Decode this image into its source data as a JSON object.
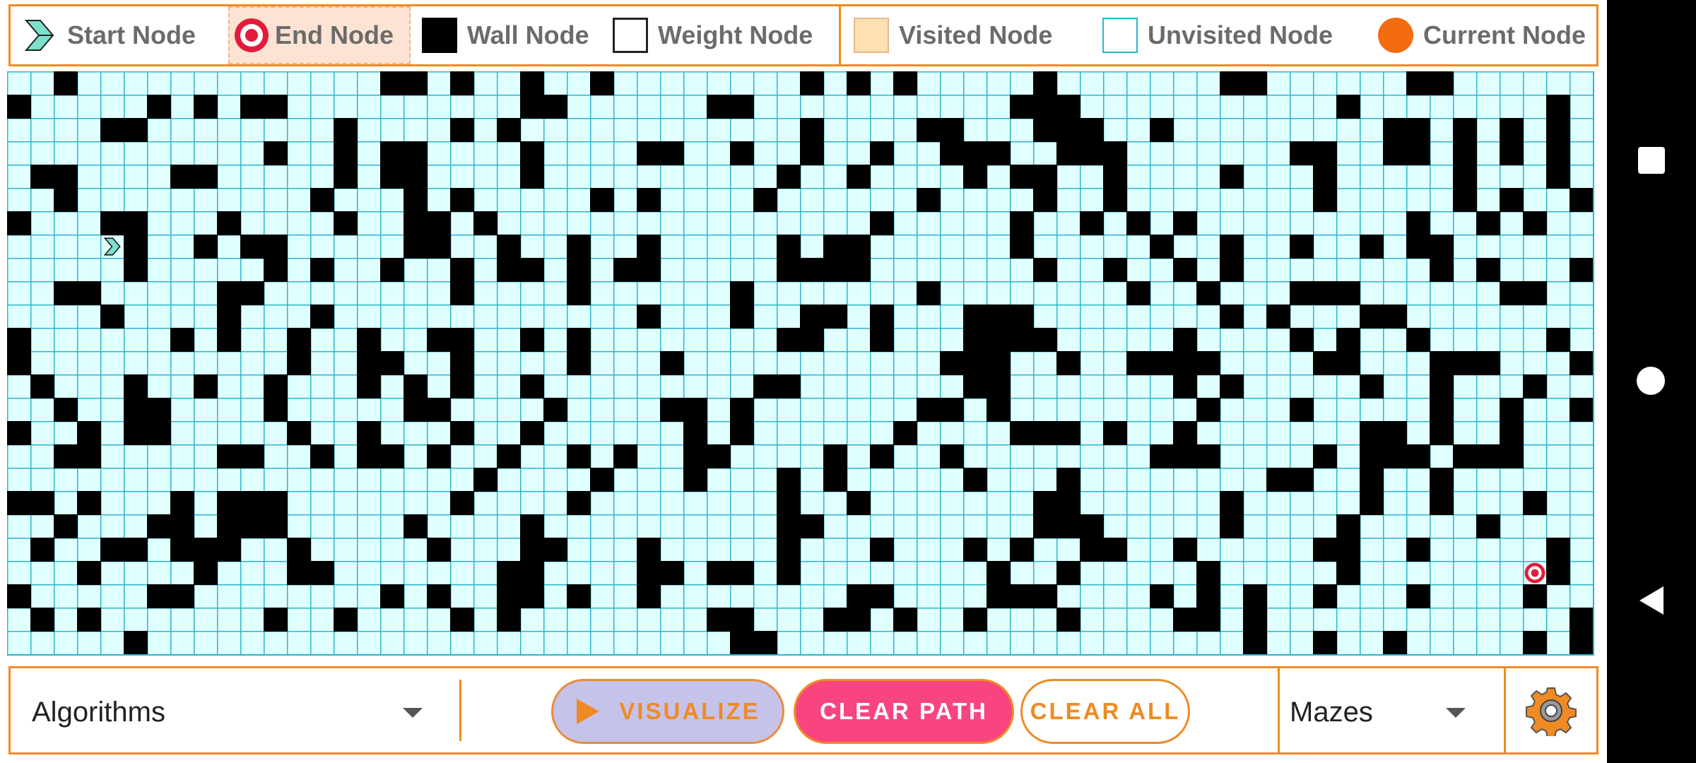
{
  "legend": {
    "start_label": "Start Node",
    "end_label": "End Node",
    "wall_label": "Wall Node",
    "weight_label": "Weight Node",
    "visited_label": "Visited Node",
    "unvisited_label": "Unvisited Node",
    "current_label": "Current Node"
  },
  "toolbar": {
    "algorithms_label": "Algorithms",
    "visualize_label": "VISUALIZE",
    "clear_path_label": "CLEAR PATH",
    "clear_all_label": "CLEAR ALL",
    "mazes_label": "Mazes"
  },
  "colors": {
    "accent": "#f08a24",
    "grid_line": "#2bb6cc",
    "unvisited": "#e0ffff",
    "visited": "#ffe0b2",
    "wall": "#000000",
    "start": "#7be0cc",
    "end": "#e31b3a",
    "current": "#f36c10",
    "clear_path_bg": "#f8457f",
    "visualize_bg": "#c5c3e9"
  },
  "icons": {
    "start": "start-chevron-icon",
    "end": "target-icon",
    "settings": "gear-icon",
    "play": "play-icon",
    "dropdown": "chevron-down-icon"
  },
  "grid": {
    "cols": 68,
    "rows": 25,
    "start": [
      7,
      4
    ],
    "end": [
      21,
      65
    ],
    "walls": [
      [
        0,
        2
      ],
      [
        0,
        16
      ],
      [
        0,
        17
      ],
      [
        0,
        19
      ],
      [
        0,
        22
      ],
      [
        0,
        25
      ],
      [
        0,
        34
      ],
      [
        0,
        36
      ],
      [
        0,
        38
      ],
      [
        0,
        44
      ],
      [
        0,
        52
      ],
      [
        0,
        53
      ],
      [
        0,
        60
      ],
      [
        0,
        61
      ],
      [
        1,
        0
      ],
      [
        1,
        6
      ],
      [
        1,
        8
      ],
      [
        1,
        10
      ],
      [
        1,
        11
      ],
      [
        1,
        22
      ],
      [
        1,
        23
      ],
      [
        1,
        30
      ],
      [
        1,
        31
      ],
      [
        1,
        43
      ],
      [
        1,
        44
      ],
      [
        1,
        45
      ],
      [
        1,
        57
      ],
      [
        1,
        66
      ],
      [
        2,
        4
      ],
      [
        2,
        5
      ],
      [
        2,
        14
      ],
      [
        2,
        19
      ],
      [
        2,
        21
      ],
      [
        2,
        34
      ],
      [
        2,
        39
      ],
      [
        2,
        40
      ],
      [
        2,
        44
      ],
      [
        2,
        45
      ],
      [
        2,
        46
      ],
      [
        2,
        49
      ],
      [
        2,
        59
      ],
      [
        2,
        60
      ],
      [
        2,
        62
      ],
      [
        2,
        64
      ],
      [
        2,
        66
      ],
      [
        3,
        11
      ],
      [
        3,
        14
      ],
      [
        3,
        16
      ],
      [
        3,
        17
      ],
      [
        3,
        22
      ],
      [
        3,
        27
      ],
      [
        3,
        28
      ],
      [
        3,
        31
      ],
      [
        3,
        34
      ],
      [
        3,
        37
      ],
      [
        3,
        40
      ],
      [
        3,
        41
      ],
      [
        3,
        42
      ],
      [
        3,
        45
      ],
      [
        3,
        46
      ],
      [
        3,
        47
      ],
      [
        3,
        55
      ],
      [
        3,
        56
      ],
      [
        3,
        59
      ],
      [
        3,
        60
      ],
      [
        3,
        62
      ],
      [
        3,
        64
      ],
      [
        3,
        66
      ],
      [
        4,
        1
      ],
      [
        4,
        2
      ],
      [
        4,
        7
      ],
      [
        4,
        8
      ],
      [
        4,
        14
      ],
      [
        4,
        16
      ],
      [
        4,
        17
      ],
      [
        4,
        22
      ],
      [
        4,
        33
      ],
      [
        4,
        36
      ],
      [
        4,
        41
      ],
      [
        4,
        43
      ],
      [
        4,
        44
      ],
      [
        4,
        47
      ],
      [
        4,
        52
      ],
      [
        4,
        56
      ],
      [
        4,
        62
      ],
      [
        4,
        66
      ],
      [
        5,
        2
      ],
      [
        5,
        13
      ],
      [
        5,
        17
      ],
      [
        5,
        19
      ],
      [
        5,
        25
      ],
      [
        5,
        27
      ],
      [
        5,
        32
      ],
      [
        5,
        39
      ],
      [
        5,
        44
      ],
      [
        5,
        47
      ],
      [
        5,
        56
      ],
      [
        5,
        62
      ],
      [
        5,
        64
      ],
      [
        5,
        67
      ],
      [
        6,
        0
      ],
      [
        6,
        4
      ],
      [
        6,
        5
      ],
      [
        6,
        9
      ],
      [
        6,
        14
      ],
      [
        6,
        17
      ],
      [
        6,
        18
      ],
      [
        6,
        20
      ],
      [
        6,
        37
      ],
      [
        6,
        43
      ],
      [
        6,
        46
      ],
      [
        6,
        48
      ],
      [
        6,
        50
      ],
      [
        6,
        60
      ],
      [
        6,
        63
      ],
      [
        6,
        65
      ],
      [
        7,
        5
      ],
      [
        7,
        8
      ],
      [
        7,
        10
      ],
      [
        7,
        11
      ],
      [
        7,
        17
      ],
      [
        7,
        18
      ],
      [
        7,
        21
      ],
      [
        7,
        24
      ],
      [
        7,
        27
      ],
      [
        7,
        33
      ],
      [
        7,
        35
      ],
      [
        7,
        36
      ],
      [
        7,
        43
      ],
      [
        7,
        49
      ],
      [
        7,
        52
      ],
      [
        7,
        55
      ],
      [
        7,
        58
      ],
      [
        7,
        60
      ],
      [
        7,
        61
      ],
      [
        8,
        5
      ],
      [
        8,
        11
      ],
      [
        8,
        13
      ],
      [
        8,
        16
      ],
      [
        8,
        19
      ],
      [
        8,
        21
      ],
      [
        8,
        22
      ],
      [
        8,
        24
      ],
      [
        8,
        26
      ],
      [
        8,
        27
      ],
      [
        8,
        33
      ],
      [
        8,
        34
      ],
      [
        8,
        35
      ],
      [
        8,
        36
      ],
      [
        8,
        44
      ],
      [
        8,
        47
      ],
      [
        8,
        50
      ],
      [
        8,
        52
      ],
      [
        8,
        61
      ],
      [
        8,
        63
      ],
      [
        8,
        67
      ],
      [
        9,
        2
      ],
      [
        9,
        3
      ],
      [
        9,
        9
      ],
      [
        9,
        10
      ],
      [
        9,
        19
      ],
      [
        9,
        24
      ],
      [
        9,
        31
      ],
      [
        9,
        39
      ],
      [
        9,
        48
      ],
      [
        9,
        51
      ],
      [
        9,
        55
      ],
      [
        9,
        56
      ],
      [
        9,
        57
      ],
      [
        9,
        64
      ],
      [
        9,
        65
      ],
      [
        10,
        4
      ],
      [
        10,
        9
      ],
      [
        10,
        13
      ],
      [
        10,
        27
      ],
      [
        10,
        31
      ],
      [
        10,
        34
      ],
      [
        10,
        35
      ],
      [
        10,
        37
      ],
      [
        10,
        41
      ],
      [
        10,
        42
      ],
      [
        10,
        43
      ],
      [
        10,
        52
      ],
      [
        10,
        54
      ],
      [
        10,
        58
      ],
      [
        10,
        59
      ],
      [
        11,
        0
      ],
      [
        11,
        7
      ],
      [
        11,
        9
      ],
      [
        11,
        12
      ],
      [
        11,
        15
      ],
      [
        11,
        18
      ],
      [
        11,
        19
      ],
      [
        11,
        22
      ],
      [
        11,
        24
      ],
      [
        11,
        33
      ],
      [
        11,
        34
      ],
      [
        11,
        37
      ],
      [
        11,
        41
      ],
      [
        11,
        42
      ],
      [
        11,
        43
      ],
      [
        11,
        44
      ],
      [
        11,
        50
      ],
      [
        11,
        55
      ],
      [
        11,
        57
      ],
      [
        11,
        60
      ],
      [
        11,
        66
      ],
      [
        12,
        0
      ],
      [
        12,
        12
      ],
      [
        12,
        15
      ],
      [
        12,
        16
      ],
      [
        12,
        19
      ],
      [
        12,
        24
      ],
      [
        12,
        28
      ],
      [
        12,
        40
      ],
      [
        12,
        41
      ],
      [
        12,
        42
      ],
      [
        12,
        45
      ],
      [
        12,
        48
      ],
      [
        12,
        49
      ],
      [
        12,
        50
      ],
      [
        12,
        51
      ],
      [
        12,
        56
      ],
      [
        12,
        57
      ],
      [
        12,
        61
      ],
      [
        12,
        62
      ],
      [
        12,
        63
      ],
      [
        12,
        67
      ],
      [
        13,
        1
      ],
      [
        13,
        5
      ],
      [
        13,
        8
      ],
      [
        13,
        11
      ],
      [
        13,
        15
      ],
      [
        13,
        17
      ],
      [
        13,
        19
      ],
      [
        13,
        22
      ],
      [
        13,
        32
      ],
      [
        13,
        33
      ],
      [
        13,
        41
      ],
      [
        13,
        42
      ],
      [
        13,
        50
      ],
      [
        13,
        52
      ],
      [
        13,
        58
      ],
      [
        13,
        61
      ],
      [
        13,
        65
      ],
      [
        14,
        2
      ],
      [
        14,
        5
      ],
      [
        14,
        6
      ],
      [
        14,
        11
      ],
      [
        14,
        17
      ],
      [
        14,
        18
      ],
      [
        14,
        23
      ],
      [
        14,
        28
      ],
      [
        14,
        29
      ],
      [
        14,
        31
      ],
      [
        14,
        39
      ],
      [
        14,
        40
      ],
      [
        14,
        42
      ],
      [
        14,
        51
      ],
      [
        14,
        55
      ],
      [
        14,
        61
      ],
      [
        14,
        64
      ],
      [
        14,
        67
      ],
      [
        15,
        0
      ],
      [
        15,
        3
      ],
      [
        15,
        5
      ],
      [
        15,
        6
      ],
      [
        15,
        12
      ],
      [
        15,
        15
      ],
      [
        15,
        19
      ],
      [
        15,
        22
      ],
      [
        15,
        29
      ],
      [
        15,
        31
      ],
      [
        15,
        38
      ],
      [
        15,
        43
      ],
      [
        15,
        44
      ],
      [
        15,
        45
      ],
      [
        15,
        47
      ],
      [
        15,
        50
      ],
      [
        15,
        58
      ],
      [
        15,
        59
      ],
      [
        15,
        61
      ],
      [
        15,
        64
      ],
      [
        16,
        2
      ],
      [
        16,
        3
      ],
      [
        16,
        9
      ],
      [
        16,
        10
      ],
      [
        16,
        13
      ],
      [
        16,
        15
      ],
      [
        16,
        16
      ],
      [
        16,
        18
      ],
      [
        16,
        21
      ],
      [
        16,
        24
      ],
      [
        16,
        26
      ],
      [
        16,
        29
      ],
      [
        16,
        30
      ],
      [
        16,
        35
      ],
      [
        16,
        37
      ],
      [
        16,
        40
      ],
      [
        16,
        49
      ],
      [
        16,
        50
      ],
      [
        16,
        51
      ],
      [
        16,
        56
      ],
      [
        16,
        58
      ],
      [
        16,
        59
      ],
      [
        16,
        60
      ],
      [
        16,
        62
      ],
      [
        16,
        63
      ],
      [
        16,
        64
      ],
      [
        17,
        20
      ],
      [
        17,
        25
      ],
      [
        17,
        29
      ],
      [
        17,
        33
      ],
      [
        17,
        35
      ],
      [
        17,
        41
      ],
      [
        17,
        45
      ],
      [
        17,
        54
      ],
      [
        17,
        55
      ],
      [
        17,
        58
      ],
      [
        17,
        61
      ],
      [
        18,
        0
      ],
      [
        18,
        1
      ],
      [
        18,
        3
      ],
      [
        18,
        7
      ],
      [
        18,
        9
      ],
      [
        18,
        10
      ],
      [
        18,
        11
      ],
      [
        18,
        19
      ],
      [
        18,
        24
      ],
      [
        18,
        33
      ],
      [
        18,
        36
      ],
      [
        18,
        44
      ],
      [
        18,
        45
      ],
      [
        18,
        52
      ],
      [
        18,
        58
      ],
      [
        18,
        61
      ],
      [
        18,
        65
      ],
      [
        19,
        2
      ],
      [
        19,
        6
      ],
      [
        19,
        7
      ],
      [
        19,
        9
      ],
      [
        19,
        10
      ],
      [
        19,
        11
      ],
      [
        19,
        17
      ],
      [
        19,
        22
      ],
      [
        19,
        33
      ],
      [
        19,
        34
      ],
      [
        19,
        44
      ],
      [
        19,
        45
      ],
      [
        19,
        46
      ],
      [
        19,
        52
      ],
      [
        19,
        57
      ],
      [
        19,
        63
      ],
      [
        20,
        1
      ],
      [
        20,
        4
      ],
      [
        20,
        5
      ],
      [
        20,
        7
      ],
      [
        20,
        8
      ],
      [
        20,
        9
      ],
      [
        20,
        12
      ],
      [
        20,
        18
      ],
      [
        20,
        22
      ],
      [
        20,
        23
      ],
      [
        20,
        27
      ],
      [
        20,
        33
      ],
      [
        20,
        37
      ],
      [
        20,
        41
      ],
      [
        20,
        43
      ],
      [
        20,
        46
      ],
      [
        20,
        47
      ],
      [
        20,
        50
      ],
      [
        20,
        56
      ],
      [
        20,
        57
      ],
      [
        20,
        60
      ],
      [
        20,
        66
      ],
      [
        21,
        3
      ],
      [
        21,
        8
      ],
      [
        21,
        12
      ],
      [
        21,
        13
      ],
      [
        21,
        21
      ],
      [
        21,
        22
      ],
      [
        21,
        27
      ],
      [
        21,
        28
      ],
      [
        21,
        30
      ],
      [
        21,
        31
      ],
      [
        21,
        33
      ],
      [
        21,
        42
      ],
      [
        21,
        45
      ],
      [
        21,
        51
      ],
      [
        21,
        57
      ],
      [
        21,
        66
      ],
      [
        22,
        0
      ],
      [
        22,
        6
      ],
      [
        22,
        7
      ],
      [
        22,
        16
      ],
      [
        22,
        18
      ],
      [
        22,
        21
      ],
      [
        22,
        22
      ],
      [
        22,
        24
      ],
      [
        22,
        27
      ],
      [
        22,
        36
      ],
      [
        22,
        37
      ],
      [
        22,
        42
      ],
      [
        22,
        43
      ],
      [
        22,
        44
      ],
      [
        22,
        49
      ],
      [
        22,
        51
      ],
      [
        22,
        53
      ],
      [
        22,
        56
      ],
      [
        22,
        60
      ],
      [
        22,
        65
      ],
      [
        23,
        1
      ],
      [
        23,
        3
      ],
      [
        23,
        11
      ],
      [
        23,
        14
      ],
      [
        23,
        19
      ],
      [
        23,
        21
      ],
      [
        23,
        30
      ],
      [
        23,
        31
      ],
      [
        23,
        35
      ],
      [
        23,
        36
      ],
      [
        23,
        38
      ],
      [
        23,
        41
      ],
      [
        23,
        45
      ],
      [
        23,
        50
      ],
      [
        23,
        51
      ],
      [
        23,
        53
      ],
      [
        23,
        67
      ],
      [
        24,
        5
      ],
      [
        24,
        31
      ],
      [
        24,
        32
      ],
      [
        24,
        53
      ],
      [
        24,
        56
      ],
      [
        24,
        59
      ],
      [
        24,
        65
      ],
      [
        24,
        67
      ]
    ]
  }
}
